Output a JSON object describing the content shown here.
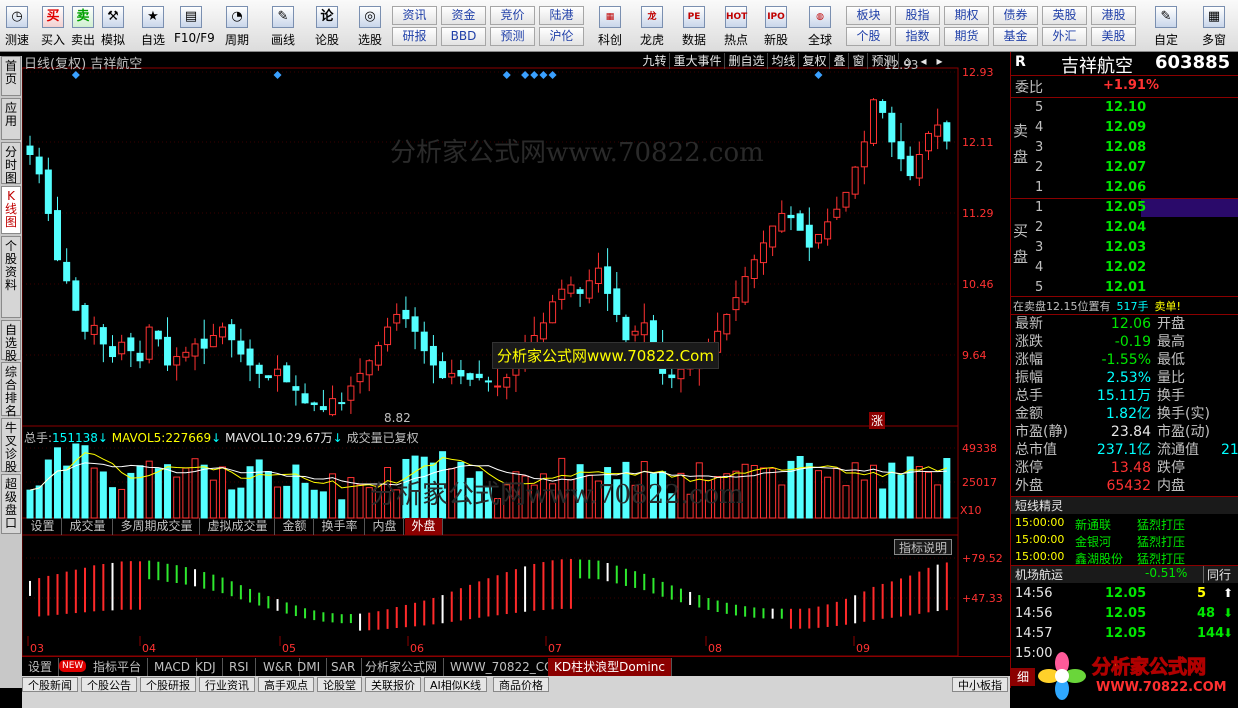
{
  "toolbar": {
    "buttons": [
      {
        "label": "测速",
        "icon": "clock-icon",
        "glyph": "◷"
      },
      {
        "label": "买入",
        "icon": "buy-icon",
        "glyph": "买"
      },
      {
        "label": "卖出",
        "icon": "sell-icon",
        "glyph": "卖"
      },
      {
        "label": "模拟",
        "icon": "hammer-icon",
        "glyph": "⚒"
      },
      {
        "label": "自选",
        "icon": "star-icon",
        "glyph": "★"
      },
      {
        "label": "F10/F9",
        "icon": "f10-icon",
        "glyph": "▤"
      },
      {
        "label": "周期",
        "icon": "cycle-icon",
        "glyph": "◔"
      },
      {
        "label": "画线",
        "icon": "pen-icon",
        "glyph": "✎"
      },
      {
        "label": "论股",
        "icon": "discuss-icon",
        "glyph": "论"
      },
      {
        "label": "选股",
        "icon": "select-icon",
        "glyph": "◎"
      }
    ],
    "center_buttons": [
      [
        "资讯",
        "资金",
        "竞价",
        "陆港"
      ],
      [
        "研报",
        "BBD",
        "预测",
        "沪伦"
      ]
    ],
    "mid_buttons": [
      {
        "label": "科创",
        "icon": "chart-icon",
        "glyph": "▦"
      },
      {
        "label": "龙虎",
        "icon": "dragon-icon",
        "glyph": "龙"
      },
      {
        "label": "数据",
        "icon": "pe-icon",
        "glyph": "PE"
      },
      {
        "label": "热点",
        "icon": "hot-icon",
        "glyph": "HOT"
      },
      {
        "label": "新股",
        "icon": "ipo-icon",
        "glyph": "IPO"
      },
      {
        "label": "全球",
        "icon": "globe-icon",
        "glyph": "◍"
      }
    ],
    "right_buttons": [
      [
        "板块",
        "股指",
        "期权",
        "债券",
        "英股",
        "港股"
      ],
      [
        "个股",
        "指数",
        "期货",
        "基金",
        "外汇",
        "美股"
      ]
    ],
    "far_right": [
      {
        "label": "自定",
        "icon": "custom-icon",
        "glyph": "✎"
      },
      {
        "label": "多窗",
        "icon": "window-icon",
        "glyph": "▦"
      }
    ]
  },
  "side_tabs": [
    "首页",
    "应用",
    "分时图",
    "K线图",
    "个股资料",
    "自选股",
    "综合排名",
    "牛叉诊股",
    "超级盘口"
  ],
  "chart_header": {
    "title": "日线(复权) 吉祥航空",
    "buttons": [
      "九转",
      "重大事件",
      "删自选",
      "均线",
      "复权",
      "叠",
      "窗",
      "预测"
    ]
  },
  "watermark_top": "分析家公式网www.70822.com",
  "watermark_center": "分析家公式网www.70822.Com",
  "watermark_mid": "分析家公式网www.70822.com",
  "price_axis": [
    "12.93",
    "12.11",
    "11.29",
    "10.46",
    "9.64"
  ],
  "high_label": "12.93",
  "low_label": "8.82",
  "zhang_label": "涨",
  "volume_header": {
    "total_label": "总手:",
    "total_value": "151138",
    "ma5_label": "MAVOL5:",
    "ma5_value": "227669",
    "ma10_label": "MAVOL10:",
    "ma10_value": "29.67万",
    "note": "成交量已复权"
  },
  "volume_axis": [
    "49338",
    "25017",
    "X10"
  ],
  "indicator_tabs": [
    "设置",
    "成交量",
    "多周期成交量",
    "虚拟成交量",
    "金额",
    "换手率",
    "内盘",
    "外盘"
  ],
  "indicator_explain": "指标说明",
  "kd_axis": [
    "+79.52",
    "+47.33"
  ],
  "month_labels": [
    "03",
    "04",
    "05",
    "06",
    "07",
    "08",
    "09"
  ],
  "bottom_tabs": [
    "设置",
    "NEW",
    "指标平台",
    "MACD",
    "KDJ",
    "RSI",
    "W&R",
    "DMI",
    "SAR",
    "分析家公式网",
    "WWW_70822_COM",
    "KD柱状浪型Dominc"
  ],
  "info_tabs": [
    "个股新闻",
    "个股公告",
    "个股研报",
    "行业资讯",
    "高手观点",
    "论股堂",
    "关联报价",
    "AI相似K线",
    "商品价格",
    "中小板指"
  ],
  "quote": {
    "name": "吉祥航空",
    "code": "603885",
    "r_label": "R",
    "weibi_label": "委比",
    "weibi_value": "+1.91%",
    "sell_label": "卖盘",
    "buy_label": "买盘",
    "asks": [
      {
        "lvl": "5",
        "price": "12.10"
      },
      {
        "lvl": "4",
        "price": "12.09"
      },
      {
        "lvl": "3",
        "price": "12.08"
      },
      {
        "lvl": "2",
        "price": "12.07"
      },
      {
        "lvl": "1",
        "price": "12.06"
      }
    ],
    "bids": [
      {
        "lvl": "1",
        "price": "12.05"
      },
      {
        "lvl": "2",
        "price": "12.04"
      },
      {
        "lvl": "3",
        "price": "12.03"
      },
      {
        "lvl": "4",
        "price": "12.02"
      },
      {
        "lvl": "5",
        "price": "12.01"
      }
    ],
    "notice_prefix": "在卖盘12.15位置有",
    "notice_qty": "517手",
    "notice_suffix": "卖单!",
    "fund": [
      {
        "l": "最新",
        "v": "12.06",
        "c": "grn",
        "l2": "开盘",
        "v2": ""
      },
      {
        "l": "涨跌",
        "v": "-0.19",
        "c": "grn",
        "l2": "最高",
        "v2": ""
      },
      {
        "l": "涨幅",
        "v": "-1.55%",
        "c": "grn",
        "l2": "最低",
        "v2": ""
      },
      {
        "l": "振幅",
        "v": "2.53%",
        "c": "cyan",
        "l2": "量比",
        "v2": ""
      },
      {
        "l": "总手",
        "v": "15.11万",
        "c": "cyan",
        "l2": "换手",
        "v2": ""
      },
      {
        "l": "金额",
        "v": "1.82亿",
        "c": "cyan",
        "l2": "换手(实)",
        "v2": ""
      },
      {
        "l": "市盈(静)",
        "v": "23.84",
        "c": "wht",
        "l2": "市盈(动)",
        "v2": ""
      },
      {
        "l": "总市值",
        "v": "237.1亿",
        "c": "cyan",
        "l2": "流通值",
        "v2": "21"
      },
      {
        "l": "涨停",
        "v": "13.48",
        "c": "red",
        "l2": "跌停",
        "v2": ""
      },
      {
        "l": "外盘",
        "v": "65432",
        "c": "red",
        "l2": "内盘",
        "v2": ""
      }
    ],
    "spirit_title": "短线精灵",
    "spirit": [
      {
        "t": "15:00:00",
        "n": "新通联",
        "e": "猛烈打压"
      },
      {
        "t": "15:00:00",
        "n": "金银河",
        "e": "猛烈打压"
      },
      {
        "t": "15:00:00",
        "n": "鑫湖股份",
        "e": "猛烈打压"
      }
    ],
    "sector_name": "机场航运",
    "sector_chg": "-0.51%",
    "sector_tab": "同行",
    "ticks": [
      {
        "t": "14:56",
        "p": "12.05",
        "q": "5",
        "d": "up"
      },
      {
        "t": "14:56",
        "p": "12.05",
        "q": "48",
        "d": "down"
      },
      {
        "t": "14:57",
        "p": "12.05",
        "q": "144",
        "d": "down"
      },
      {
        "t": "15:00",
        "p": "",
        "q": "",
        "d": ""
      }
    ],
    "bottom_tab": "细"
  },
  "logo_text": "分析家公式网",
  "logo_url": "WWW.70822.COM",
  "chart_data": {
    "type": "candlestick",
    "title": "日线(复权) 吉祥航空",
    "x_months": [
      "03",
      "04",
      "05",
      "06",
      "07",
      "08",
      "09"
    ],
    "price_range": [
      8.82,
      12.93
    ],
    "closes": [
      11.95,
      11.72,
      11.25,
      10.7,
      10.45,
      10.1,
      9.85,
      9.92,
      9.7,
      9.55,
      9.72,
      9.62,
      9.5,
      9.9,
      9.76,
      9.45,
      9.55,
      9.6,
      9.7,
      9.65,
      9.8,
      9.9,
      9.75,
      9.58,
      9.45,
      9.35,
      9.3,
      9.4,
      9.25,
      9.15,
      9.0,
      8.98,
      8.92,
      9.05,
      9.0,
      9.2,
      9.35,
      9.5,
      9.68,
      9.9,
      10.05,
      10.0,
      9.85,
      9.62,
      9.45,
      9.3,
      9.35,
      9.32,
      9.28,
      9.3,
      9.25,
      9.2,
      9.3,
      9.42,
      9.6,
      9.8,
      9.95,
      10.2,
      10.35,
      10.4,
      10.3,
      10.45,
      10.6,
      10.3,
      10.05,
      9.75,
      9.85,
      9.95,
      9.6,
      9.35,
      9.3,
      9.4,
      9.45,
      9.55,
      9.65,
      9.85,
      10.05,
      10.25,
      10.5,
      10.7,
      10.9,
      11.1,
      11.25,
      11.2,
      11.05,
      10.85,
      11.0,
      11.15,
      11.3,
      11.5,
      11.8,
      12.1,
      12.6,
      12.45,
      12.1,
      11.9,
      11.7,
      11.95,
      12.2,
      12.3,
      12.11
    ],
    "volume_axis_max": 49338,
    "volume_mid_tick": 25017,
    "kd_ticks": [
      79.52,
      47.33
    ]
  }
}
